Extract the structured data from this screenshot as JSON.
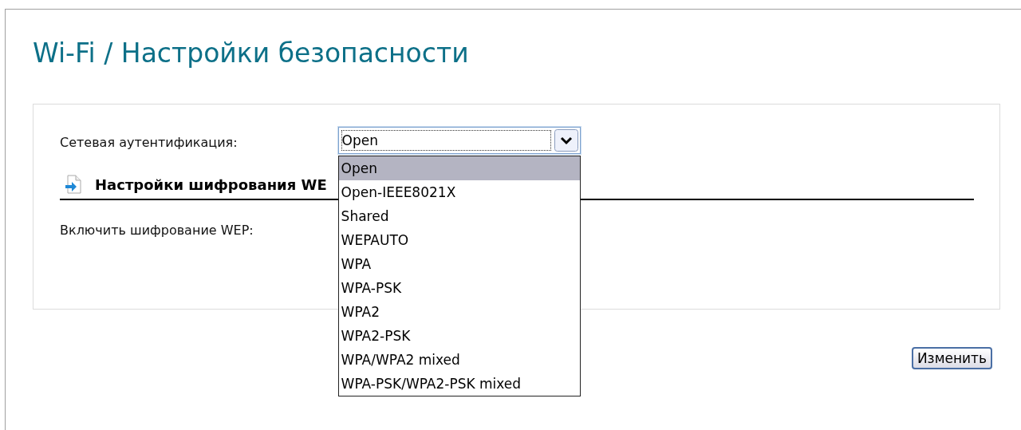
{
  "title": "Wi-Fi / Настройки безопасности",
  "auth": {
    "label": "Сетевая аутентификация:",
    "value": "Open",
    "expanded": true,
    "options": [
      {
        "label": "Open",
        "selected": true
      },
      {
        "label": "Open-IEEE8021X",
        "selected": false
      },
      {
        "label": "Shared",
        "selected": false
      },
      {
        "label": "WEPAUTO",
        "selected": false
      },
      {
        "label": "WPA",
        "selected": false
      },
      {
        "label": "WPA-PSK",
        "selected": false
      },
      {
        "label": "WPA2",
        "selected": false
      },
      {
        "label": "WPA2-PSK",
        "selected": false
      },
      {
        "label": "WPA/WPA2 mixed",
        "selected": false
      },
      {
        "label": "WPA-PSK/WPA2-PSK mixed",
        "selected": false
      }
    ]
  },
  "section": {
    "heading": "Настройки шифрования WE"
  },
  "wep": {
    "label": "Включить шифрование WEP:"
  },
  "button": "Изменить"
}
